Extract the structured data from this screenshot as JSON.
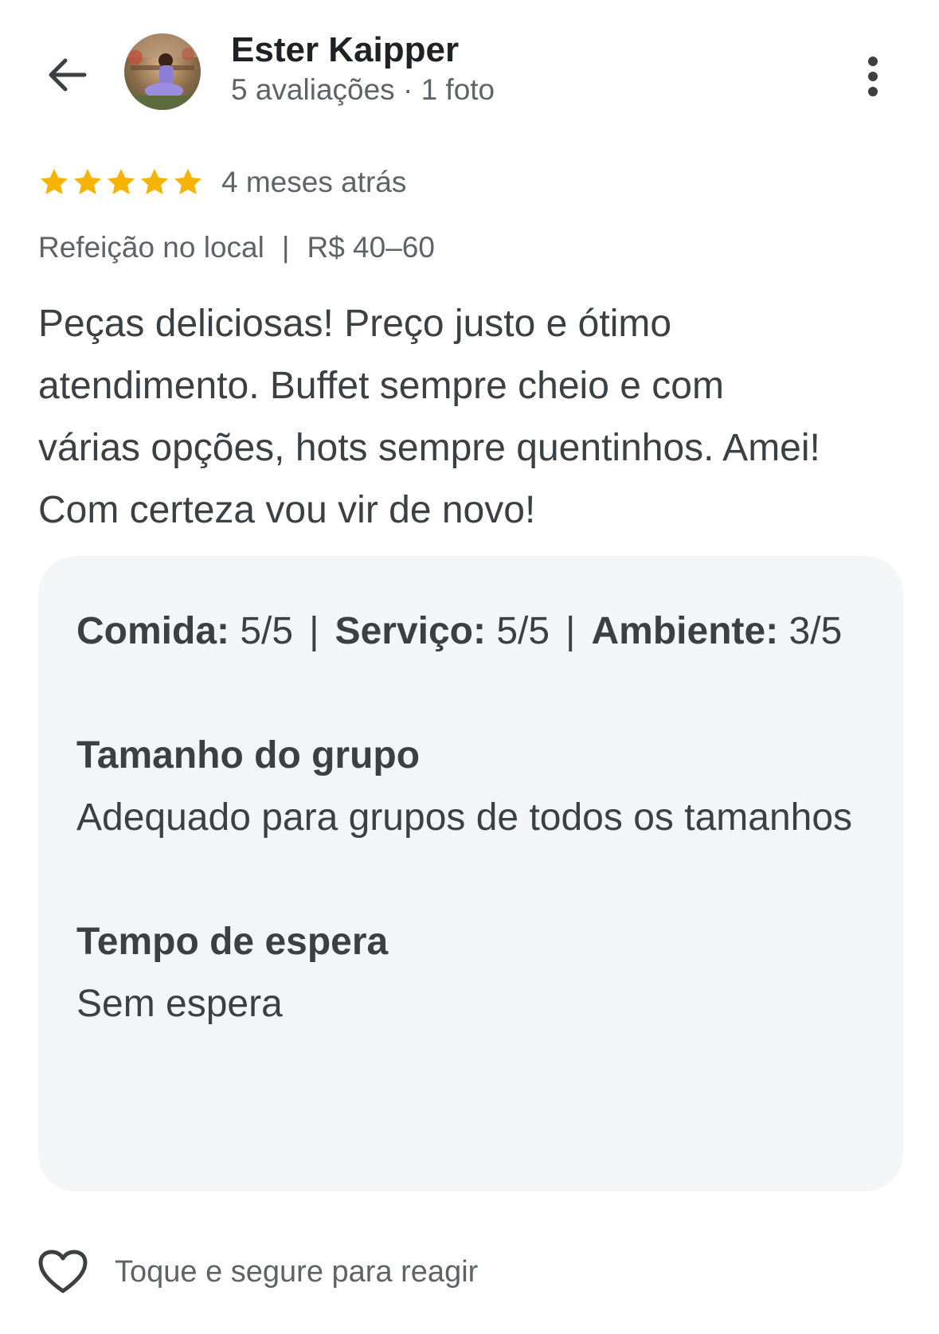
{
  "reviewer": {
    "name": "Ester Kaipper",
    "meta": "5 avaliações · 1 foto"
  },
  "review": {
    "stars": 5,
    "time_ago": "4 meses atrás",
    "service_type": "Refeição no local",
    "price_range": "R$ 40–60",
    "text": "Peças deliciosas! Preço justo e ótimo atendimento. Buffet sempre cheio e com várias opções, hots sempre quentinhos. Amei! Com certeza vou vir de novo!"
  },
  "details": {
    "ratings": [
      {
        "label": "Comida:",
        "value": "5/5"
      },
      {
        "label": "Serviço:",
        "value": "5/5"
      },
      {
        "label": "Ambiente:",
        "value": "3/5"
      }
    ],
    "group_size": {
      "title": "Tamanho do grupo",
      "value": "Adequado para grupos de todos os tamanhos"
    },
    "wait_time": {
      "title": "Tempo de espera",
      "value": "Sem espera"
    }
  },
  "react": {
    "label": "Toque e segure para reagir"
  },
  "colors": {
    "star": "#f6b400",
    "card_bg": "#f4f5f7",
    "text_primary": "#202124",
    "text_secondary": "#5f6368"
  },
  "icons": {
    "back": "arrow-left-icon",
    "more": "more-vertical-icon",
    "star": "star-icon",
    "heart": "heart-outline-icon"
  }
}
